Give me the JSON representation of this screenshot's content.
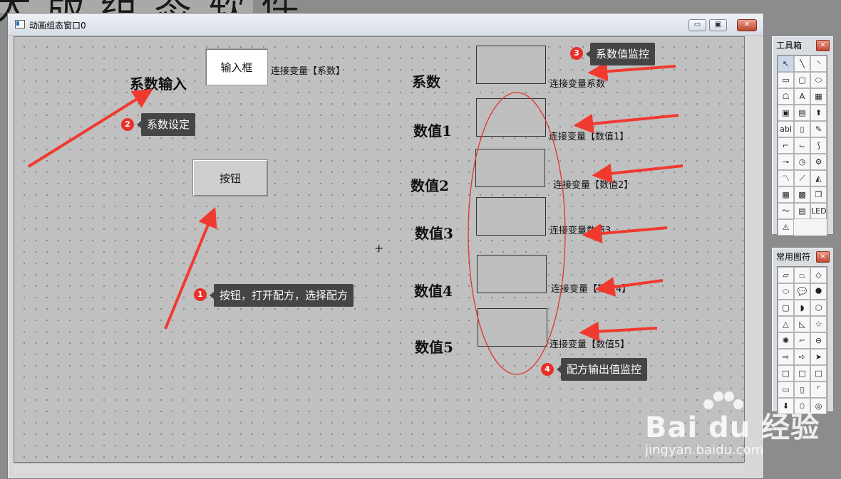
{
  "background_title": "大 版 组 态 软 件",
  "window": {
    "title": "动画组态窗口0",
    "btn_min": "▭",
    "btn_max": "▣",
    "btn_close": "✕"
  },
  "canvas": {
    "coef_input_label": "系数输入",
    "input_box_text": "输入框",
    "input_var_label": "连接变量【系数】",
    "button_text": "按钮",
    "crosshair": "+",
    "right_labels": {
      "coef": "系数",
      "v1": "数值1",
      "v2": "数值2",
      "v3": "数值3",
      "v4": "数值4",
      "v5": "数值5"
    },
    "var_labels": {
      "coef": "连接变量系数",
      "v1": "连接变量【数值1】",
      "v2": "连接变量【数值2】",
      "v3": "连接变量数值3",
      "v4": "连接变量【数值4】",
      "v5": "连接变量【数值5】"
    }
  },
  "annotations": [
    {
      "num": "1",
      "text": "按钮，打开配方，选择配方"
    },
    {
      "num": "2",
      "text": "系数设定"
    },
    {
      "num": "3",
      "text": "系数值监控"
    },
    {
      "num": "4",
      "text": "配方输出值监控"
    }
  ],
  "toolbox": {
    "title": "工具箱",
    "close": "✕",
    "icons": [
      "pointer-icon",
      "line-icon",
      "arc-icon",
      "rectangle-icon",
      "rounded-rect-icon",
      "ellipse-icon",
      "polygon-icon",
      "text-icon",
      "bitmap-icon",
      "symbol-library-icon",
      "symbol-gray-icon",
      "flow-icon",
      "label-abl-icon",
      "input-field-icon",
      "alarm-icon",
      "polyline-icon",
      "step-line-icon",
      "curve-icon",
      "slider-icon",
      "gauge-icon",
      "rotate-icon",
      "trend-icon",
      "xy-trend-icon",
      "switch-icon",
      "table-icon",
      "grid-table-icon",
      "frame-icon",
      "chart-icon",
      "report-icon",
      "led-icon",
      "window-icon"
    ],
    "glyphs": [
      "↖",
      "╲",
      "◝",
      "▭",
      "▢",
      "⬭",
      "☖",
      "A",
      "▦",
      "▣",
      "▤",
      "⬆",
      "abl",
      "▯",
      "✎",
      "⌐",
      "⌙",
      "⟆",
      "⊸",
      "◷",
      "⚙",
      "〽",
      "⟋",
      "◭",
      "▦",
      "▩",
      "❐",
      "〜",
      "▤",
      "LED",
      "⚠"
    ]
  },
  "shapes_panel": {
    "title": "常用图符",
    "close": "✕",
    "icons": [
      "parallelogram-icon",
      "trapezoid-icon",
      "diamond-icon",
      "ellipse-icon",
      "speech-bubble-icon",
      "octagon-icon",
      "cube-icon",
      "delay-icon",
      "hexagon-icon",
      "triangle-icon",
      "right-triangle-icon",
      "star-icon",
      "gear-shape-icon",
      "step-icon",
      "cylinder-icon",
      "arrow-outline-icon",
      "arrow-right-icon",
      "arrowhead-icon",
      "cyan-square-icon",
      "cyan-square2-icon",
      "cyan-square3-icon",
      "rounded-bar-icon",
      "vertical-bar-icon",
      "corner-icon",
      "tag-icon",
      "oval-icon",
      "target-icon"
    ],
    "glyphs": [
      "▱",
      "⏢",
      "◇",
      "⬭",
      "💬",
      "⯃",
      "▢",
      "◗",
      "⬡",
      "△",
      "◺",
      "☆",
      "✺",
      "⌐",
      "⊖",
      "⇨",
      "➪",
      "➤",
      "□",
      "□",
      "□",
      "▭",
      "▯",
      "⌜",
      "⬇",
      "⬯",
      "◎"
    ]
  },
  "watermark": {
    "logo": "Bai du 经验",
    "url": "jingyan.baidu.com"
  }
}
